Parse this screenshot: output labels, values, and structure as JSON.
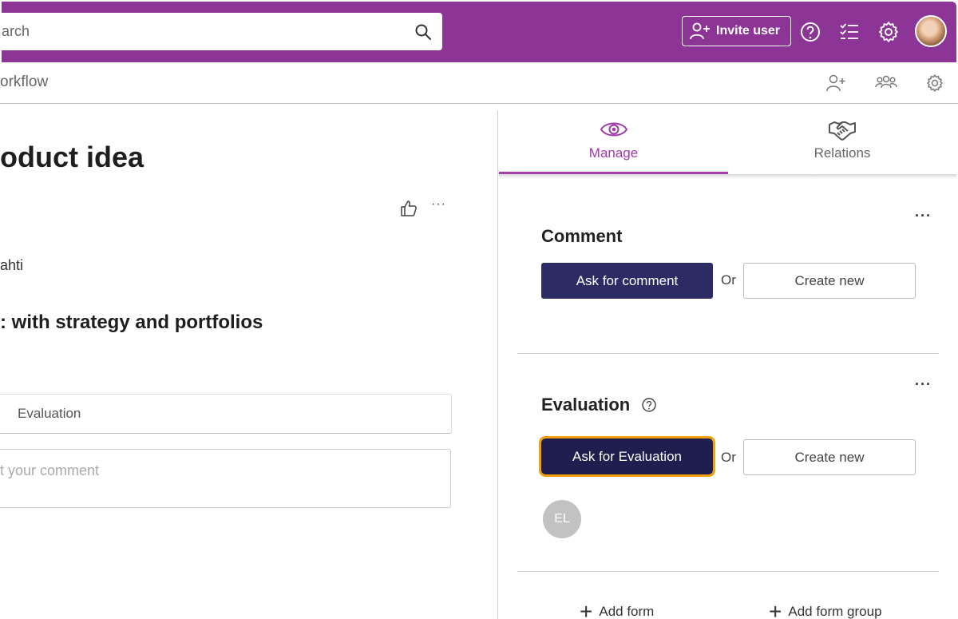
{
  "header": {
    "search_placeholder": "arch",
    "invite_label": "Invite user",
    "icons": [
      "person-add-icon",
      "help-icon",
      "checklist-icon",
      "gear-icon",
      "avatar"
    ]
  },
  "subbar": {
    "title": "orkflow",
    "icons": [
      "person-add-icon",
      "group-icon",
      "gear-icon"
    ]
  },
  "main": {
    "title": "oduct idea",
    "owner": "ahti",
    "subtitle": ": with strategy and portfolios",
    "eval_tab_label": "Evaluation",
    "comment_placeholder": "t your comment",
    "more": "···"
  },
  "panel": {
    "tabs": [
      {
        "label": "Manage",
        "icon": "eye-icon",
        "active": true
      },
      {
        "label": "Relations",
        "icon": "handshake-icon",
        "active": false
      }
    ],
    "comment": {
      "title": "Comment",
      "primary_label": "Ask for comment",
      "or_label": "Or",
      "secondary_label": "Create new",
      "more": "···"
    },
    "evaluation": {
      "title": "Evaluation",
      "primary_label": "Ask for Evaluation",
      "or_label": "Or",
      "secondary_label": "Create new",
      "assignee_initials": "EL",
      "more": "···"
    },
    "add_form_label": "Add form",
    "add_form_group_label": "Add form group"
  },
  "colors": {
    "brand": "#8d3596",
    "primary_button": "#2c2b63",
    "focus_outline": "#f2a10c",
    "active_tab": "#a73fb3"
  }
}
